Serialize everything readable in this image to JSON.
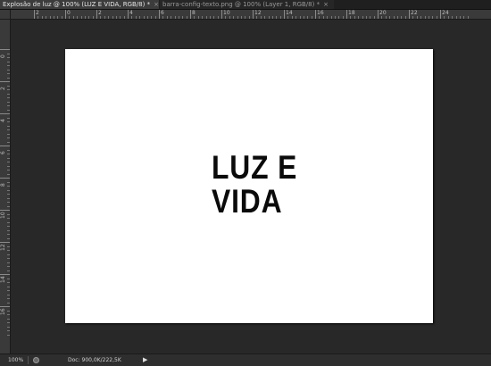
{
  "tabs": [
    {
      "label": "Explosão de luz @ 100% (LUZ E VIDA, RGB/8) *",
      "close": "×",
      "active": true
    },
    {
      "label": "barra-config-texto.png @ 100% (Layer 1, RGB/8) *",
      "close": "×",
      "active": false
    }
  ],
  "ruler_h": [
    "2",
    "0",
    "2",
    "4",
    "6",
    "8",
    "10",
    "12",
    "14",
    "16",
    "18",
    "20",
    "22",
    "24"
  ],
  "ruler_v": [
    "0",
    "2",
    "4",
    "6",
    "8",
    "10",
    "12",
    "14",
    "16"
  ],
  "canvas": {
    "line1": "LUZ E",
    "line2": "VIDA",
    "background": "#ffffff",
    "text_color": "#0a0a0a"
  },
  "status": {
    "zoom": "100%",
    "doc": "Doc: 900,0K/222,5K",
    "arrow": "▶"
  }
}
